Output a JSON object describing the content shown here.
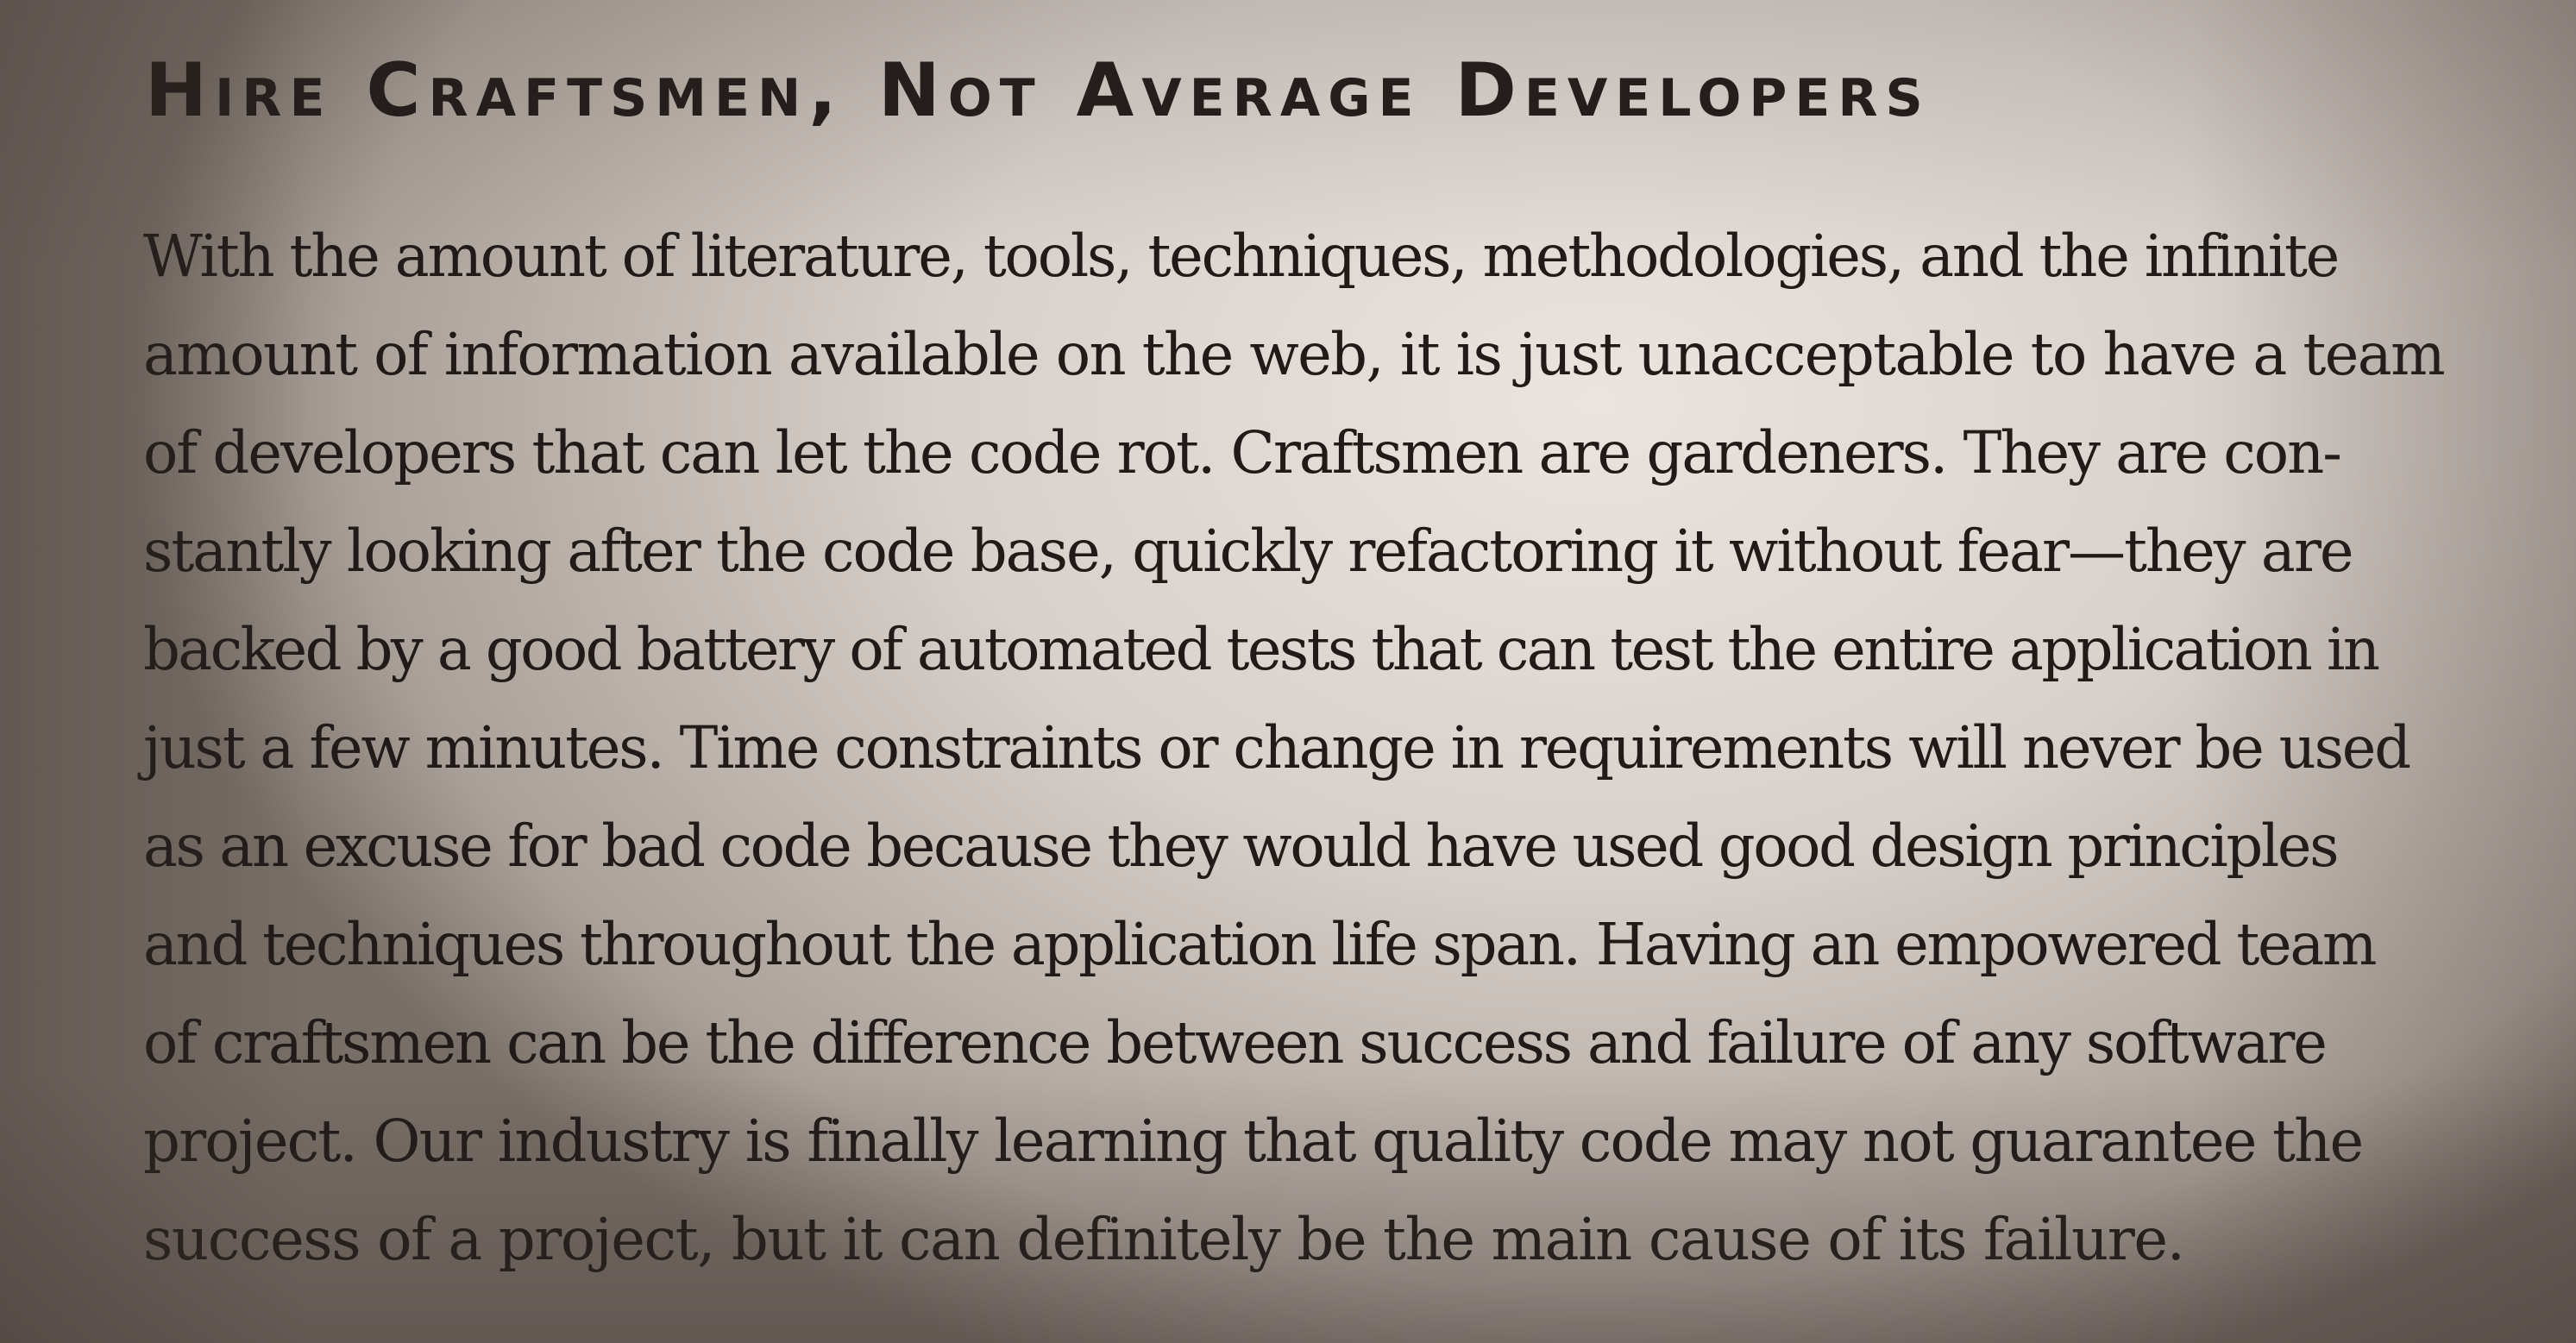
{
  "section": {
    "heading": "Hire Craftsmen, Not Average Developers",
    "lines": [
      "With the amount of literature, tools, techniques, methodologies, and the infinite",
      "amount of information available on the web, it is just unacceptable to have a team",
      "of developers that can let the code rot. Craftsmen are gardeners. They are con-",
      "stantly looking after the code base, quickly refactoring it without fear—they are",
      "backed by a good battery of automated tests that can test the entire application in",
      "just a few minutes. Time constraints or change in requirements will never be used",
      "as an excuse for bad code because they would have used good design principles",
      "and techniques throughout the application life span. Having an empowered team",
      "of craftsmen can be the difference between success and failure of any software",
      "project. Our industry is finally learning that quality code may not guarantee the",
      "success of a project, but it can definitely be the main cause of its failure."
    ]
  }
}
